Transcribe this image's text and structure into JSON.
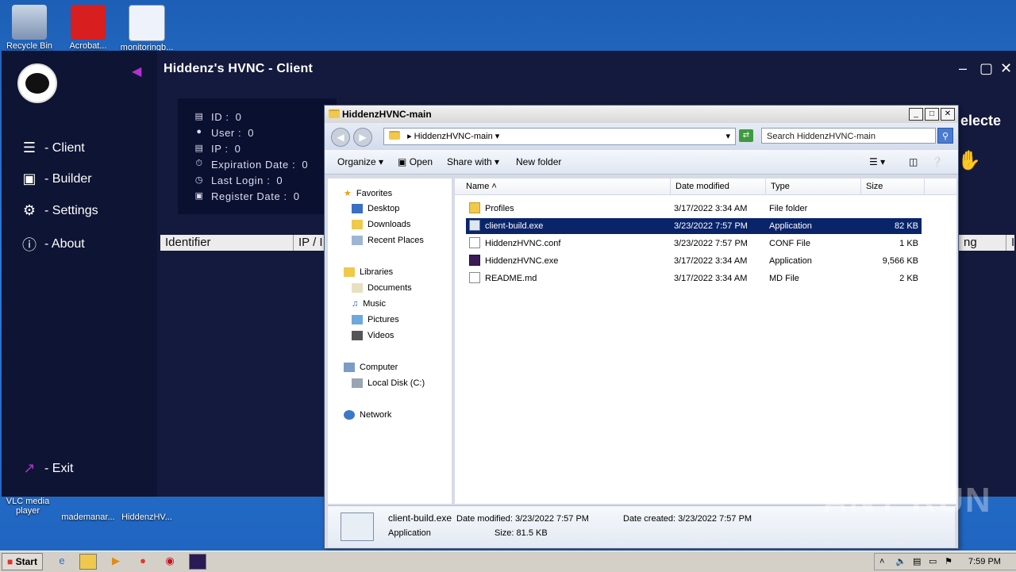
{
  "desktop": {
    "icons": [
      {
        "label": "Recycle Bin"
      },
      {
        "label": "Acrobat..."
      },
      {
        "label": "monitoringb..."
      },
      {
        "label": "VLC media player"
      },
      {
        "label": "mademanar..."
      },
      {
        "label": "HiddenzHV..."
      }
    ]
  },
  "hvnc": {
    "title": "Hiddenz's HVNC - Client",
    "nav": [
      {
        "label": "- Client",
        "icon": "list-icon"
      },
      {
        "label": "- Builder",
        "icon": "save-icon"
      },
      {
        "label": "- Settings",
        "icon": "gears-icon"
      },
      {
        "label": "- About",
        "icon": "info-icon"
      }
    ],
    "exit_label": "- Exit",
    "info": [
      {
        "label": "ID :",
        "value": "0"
      },
      {
        "label": "User :",
        "value": "0"
      },
      {
        "label": "IP :",
        "value": "0"
      },
      {
        "label": "Expiration Date :",
        "value": "0"
      },
      {
        "label": "Last Login :",
        "value": "0"
      },
      {
        "label": "Register Date :",
        "value": "0"
      }
    ],
    "grid_columns": [
      "Identifier",
      "IP / I",
      "ng",
      "In"
    ],
    "partial_text": "electe",
    "accent_color": "#b52fd2"
  },
  "explorer": {
    "title": "HiddenzHVNC-main",
    "address": "HiddenzHVNC-main",
    "search_placeholder": "Search HiddenzHVNC-main",
    "toolbar": {
      "organize": "Organize",
      "open": "Open",
      "share": "Share with",
      "new_folder": "New folder"
    },
    "nav": {
      "favorites": "Favorites",
      "desktop": "Desktop",
      "downloads": "Downloads",
      "recent": "Recent Places",
      "libraries": "Libraries",
      "documents": "Documents",
      "music": "Music",
      "pictures": "Pictures",
      "videos": "Videos",
      "computer": "Computer",
      "local_disk": "Local Disk (C:)",
      "network": "Network"
    },
    "columns": {
      "name": "Name",
      "date": "Date modified",
      "type": "Type",
      "size": "Size"
    },
    "files": [
      {
        "name": "Profiles",
        "date": "3/17/2022 3:34 AM",
        "type": "File folder",
        "size": ""
      },
      {
        "name": "client-build.exe",
        "date": "3/23/2022 7:57 PM",
        "type": "Application",
        "size": "82 KB"
      },
      {
        "name": "HiddenzHVNC.conf",
        "date": "3/23/2022 7:57 PM",
        "type": "CONF File",
        "size": "1 KB"
      },
      {
        "name": "HiddenzHVNC.exe",
        "date": "3/17/2022 3:34 AM",
        "type": "Application",
        "size": "9,566 KB"
      },
      {
        "name": "README.md",
        "date": "3/17/2022 3:34 AM",
        "type": "MD File",
        "size": "2 KB"
      }
    ],
    "details": {
      "name": "client-build.exe",
      "kind": "Application",
      "modified_label": "Date modified:",
      "modified": "3/23/2022 7:57 PM",
      "created_label": "Date created:",
      "created": "3/23/2022 7:57 PM",
      "size_label": "Size:",
      "size": "81.5 KB"
    }
  },
  "taskbar": {
    "start": "Start",
    "time": "7:59 PM"
  },
  "watermark": "ANY RUN"
}
